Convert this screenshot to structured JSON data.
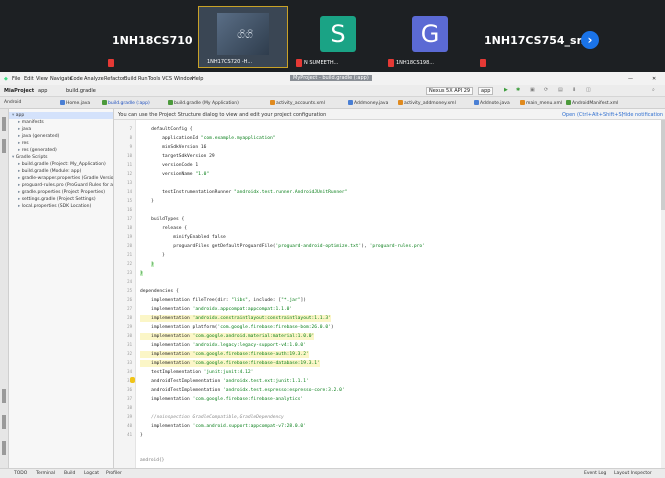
{
  "meeting": {
    "tiles": [
      {
        "name": "1NH18CS710 -...",
        "caption": "",
        "kind": "name"
      },
      {
        "name": "",
        "caption": "1NH17CS720 -H...",
        "kind": "video",
        "avatar": "ගිගි"
      },
      {
        "name": "",
        "caption": "N SUMEETH...",
        "kind": "avatar",
        "avatar": "S",
        "avatar_color": "#1aa385"
      },
      {
        "name": "",
        "caption": "1NH18CS198...",
        "kind": "avatar",
        "avatar": "G",
        "avatar_color": "#5b6ad4"
      },
      {
        "name": "1NH17CS754_sr...",
        "caption": "",
        "kind": "name"
      }
    ],
    "next_icon": "chevron-right"
  },
  "menu": {
    "items": [
      "File",
      "Edit",
      "View",
      "Navigate",
      "Code",
      "Analyze",
      "Refactor",
      "Build",
      "Run",
      "Tools",
      "VCS",
      "Window",
      "Help"
    ],
    "title": "MyProject - build.gradle (:app)",
    "minimize": "—",
    "close": "✕"
  },
  "toolbar": {
    "breadcrumb": [
      "MiaProject",
      "app",
      "build.gradle"
    ],
    "run_config": "app",
    "device": "Nexus 5X API 29"
  },
  "tabs": [
    {
      "label": "Home.java",
      "color": "#4a7fd4"
    },
    {
      "label": "build.gradle (:app)",
      "color": "#4c9a3c",
      "active": true
    },
    {
      "label": "build.gradle (My Application)",
      "color": "#4c9a3c"
    },
    {
      "label": "activity_accounts.xml",
      "color": "#e08a1e"
    },
    {
      "label": "Addmoney.java",
      "color": "#4a7fd4"
    },
    {
      "label": "activity_addmoney.xml",
      "color": "#e08a1e"
    },
    {
      "label": "Addnote.java",
      "color": "#4a7fd4"
    },
    {
      "label": "main_menu.xml",
      "color": "#e08a1e"
    },
    {
      "label": "AndroidManifest.xml",
      "color": "#4c9a3c"
    }
  ],
  "project": {
    "header": "Android",
    "rows": [
      {
        "label": "app",
        "indent": 0,
        "selected": true
      },
      {
        "label": "manifests",
        "indent": 1
      },
      {
        "label": "java",
        "indent": 1
      },
      {
        "label": "java (generated)",
        "indent": 1
      },
      {
        "label": "res",
        "indent": 1
      },
      {
        "label": "res (generated)",
        "indent": 1
      },
      {
        "label": "Gradle Scripts",
        "indent": 0
      },
      {
        "label": "build.gradle (Project: My_Application)",
        "indent": 1
      },
      {
        "label": "build.gradle (Module: app)",
        "indent": 1
      },
      {
        "label": "gradle-wrapper.properties (Gradle Version)",
        "indent": 1
      },
      {
        "label": "proguard-rules.pro (ProGuard Rules for app)",
        "indent": 1
      },
      {
        "label": "gradle.properties (Project Properties)",
        "indent": 1
      },
      {
        "label": "settings.gradle (Project Settings)",
        "indent": 1
      },
      {
        "label": "local.properties (SDK Location)",
        "indent": 1
      }
    ]
  },
  "editor": {
    "notice": "You can use the Project Structure dialog to view and edit your project configuration",
    "notice_actions": [
      "Open (Ctrl+Alt+Shift+S)",
      "Hide notification"
    ],
    "lines": [
      {
        "n": "7",
        "text": "    defaultConfig {"
      },
      {
        "n": "8",
        "text": "        applicationId \"com.example.myapplication\""
      },
      {
        "n": "9",
        "text": "        minSdkVersion 16"
      },
      {
        "n": "10",
        "text": "        targetSdkVersion 29"
      },
      {
        "n": "11",
        "text": "        versionCode 1"
      },
      {
        "n": "12",
        "text": "        versionName \"1.0\""
      },
      {
        "n": "13",
        "text": ""
      },
      {
        "n": "14",
        "text": "        testInstrumentationRunner \"androidx.test.runner.AndroidJUnitRunner\""
      },
      {
        "n": "15",
        "text": "    }"
      },
      {
        "n": "16",
        "text": ""
      },
      {
        "n": "17",
        "text": "    buildTypes {"
      },
      {
        "n": "18",
        "text": "        release {"
      },
      {
        "n": "19",
        "text": "            minifyEnabled false"
      },
      {
        "n": "20",
        "text": "            proguardFiles getDefaultProguardFile('proguard-android-optimize.txt'), 'proguard-rules.pro'"
      },
      {
        "n": "21",
        "text": "        }"
      },
      {
        "n": "22",
        "text": "    }",
        "brace": true
      },
      {
        "n": "23",
        "text": "}",
        "brace": true
      },
      {
        "n": "24",
        "text": ""
      },
      {
        "n": "25",
        "text": "dependencies {"
      },
      {
        "n": "26",
        "text": "    implementation fileTree(dir: \"libs\", include: [\"*.jar\"])"
      },
      {
        "n": "27",
        "text": "    implementation 'androidx.appcompat:appcompat:1.1.0'"
      },
      {
        "n": "28",
        "text": "    implementation 'androidx.constraintlayout:constraintlayout:1.1.3'",
        "hl": true
      },
      {
        "n": "29",
        "text": "    implementation platform('com.google.firebase:firebase-bom:26.0.0')"
      },
      {
        "n": "30",
        "text": "    implementation 'com.google.android.material:material:1.0.0'",
        "hl": true
      },
      {
        "n": "31",
        "text": "    implementation 'androidx.legacy:legacy-support-v4:1.0.0'"
      },
      {
        "n": "32",
        "text": "    implementation 'com.google.firebase:firebase-auth:19.3.2'",
        "hl": true
      },
      {
        "n": "33",
        "text": "    implementation 'com.google.firebase:firebase-database:19.3.1'",
        "hl": true
      },
      {
        "n": "34",
        "text": "    testImplementation 'junit:junit:4.12'"
      },
      {
        "n": "35",
        "text": "    androidTestImplementation 'androidx.test.ext:junit:1.1.1'"
      },
      {
        "n": "36",
        "text": "    androidTestImplementation 'androidx.test.espresso:espresso-core:3.2.0'"
      },
      {
        "n": "37",
        "text": "    implementation 'com.google.firebase:firebase-analytics'"
      },
      {
        "n": "38",
        "text": ""
      },
      {
        "n": "39",
        "text": "    //noinspection GradleCompatible,GradleDependency",
        "comment": true
      },
      {
        "n": "40",
        "text": "    implementation 'com.android.support:appcompat-v7:28.0.0'"
      },
      {
        "n": "41",
        "text": "}"
      }
    ],
    "footer": "android{}"
  },
  "status": {
    "left": [
      "TODO",
      "Terminal",
      "Build",
      "Logcat",
      "Profiler"
    ],
    "right": [
      "Event Log",
      "Layout Inspector"
    ]
  }
}
